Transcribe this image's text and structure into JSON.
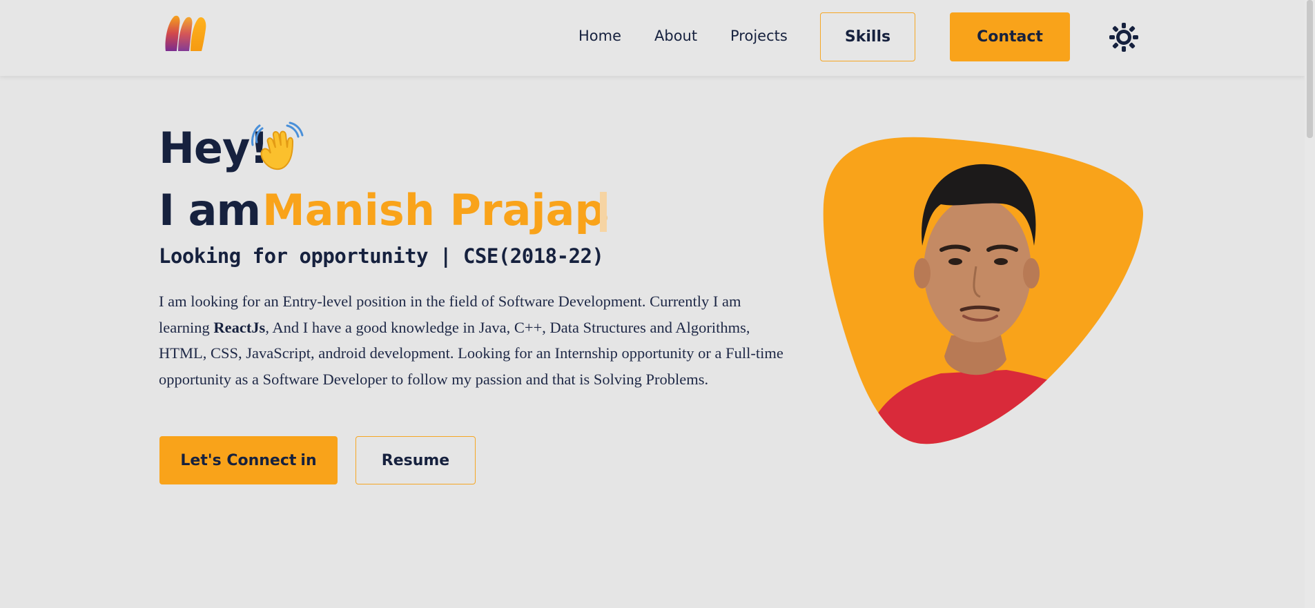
{
  "colors": {
    "accent": "#f9a31a",
    "text": "#16213e",
    "background": "#e5e5e5"
  },
  "navbar": {
    "logo_icon": "m-logo-icon",
    "links": [
      "Home",
      "About",
      "Projects"
    ],
    "skills_label": "Skills",
    "contact_label": "Contact",
    "theme_icon": "sun-icon"
  },
  "hero": {
    "greeting": "Hey!",
    "greeting_icon": "waving-hand-icon",
    "intro_prefix": "I am",
    "typed_name": "Manish Prajapa",
    "tagline": "Looking for opportunity | CSE(2018-22)",
    "bio_part1": "I am looking for an Entry-level position in the field of Software Development. Currently I am learning ",
    "bio_bold": "ReactJs",
    "bio_part2": ", And I have a good knowledge in Java, C++, Data Structures and Algorithms, HTML, CSS, JavaScript, android development. Looking for an Internship opportunity or a Full-time opportunity as a Software Developer to follow my passion and that is Solving Problems.",
    "connect_label": "Let's Connect",
    "connect_icon": "linkedin-icon",
    "resume_label": "Resume",
    "portrait_icon": "profile-photo"
  }
}
